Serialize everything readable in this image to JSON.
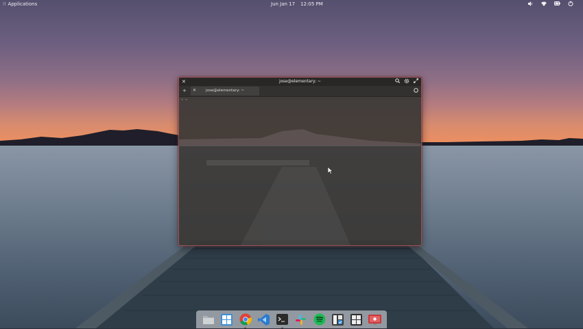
{
  "top_panel": {
    "applications_label": "Applications",
    "date": "Jun Jan 17",
    "time": "12:05 PM",
    "tray_icons": [
      "volume-icon",
      "network-icon",
      "battery-icon",
      "power-icon"
    ]
  },
  "terminal": {
    "title": "jose@elementary: ~",
    "tab_label": "jose@elementary: ~",
    "prompt_text": "~ ~"
  },
  "dock": {
    "apps": [
      {
        "name": "files-app",
        "icon": "folder-icon"
      },
      {
        "name": "multitasking-view-app",
        "icon": "grid-windows-icon"
      },
      {
        "name": "chrome-app",
        "icon": "chrome-icon"
      },
      {
        "name": "vscode-app",
        "icon": "vscode-icon"
      },
      {
        "name": "terminal-app",
        "icon": "terminal-icon"
      },
      {
        "name": "slack-app",
        "icon": "slack-icon"
      },
      {
        "name": "spotify-app",
        "icon": "spotify-icon"
      },
      {
        "name": "tasks-app",
        "icon": "tasks-icon"
      },
      {
        "name": "settings-app",
        "icon": "settings-panels-icon"
      },
      {
        "name": "screen-recorder-app",
        "icon": "screen-recorder-icon"
      }
    ]
  },
  "colors": {
    "window_border": "#a85a5f",
    "window_bg": "#3a3836",
    "dock_bg": "#e6e6e8"
  }
}
